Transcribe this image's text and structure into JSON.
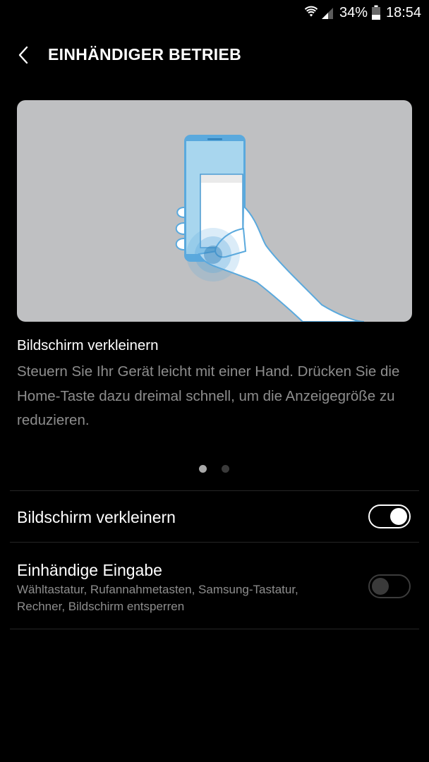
{
  "status_bar": {
    "battery_percent": "34%",
    "time": "18:54",
    "icons": [
      "wifi-icon",
      "signal-icon",
      "battery-icon"
    ]
  },
  "header": {
    "back_icon": "chevron-left-icon",
    "title": "EINHÄNDIGER BETRIEB"
  },
  "illustration": {
    "icon": "one-handed-phone-illustration",
    "pager": {
      "count": 2,
      "active_index": 0
    }
  },
  "description": {
    "title": "Bildschirm verkleinern",
    "body": "Steuern Sie Ihr Gerät leicht mit einer Hand. Drücken Sie die Home-Taste dazu dreimal schnell, um die Anzeigegröße zu reduzieren."
  },
  "settings": [
    {
      "title": "Bildschirm verkleinern",
      "subtitle": "",
      "enabled": true
    },
    {
      "title": "Einhändige Eingabe",
      "subtitle": "Wähltastatur, Rufannahmetasten, Samsung-Tastatur, Rechner, Bildschirm entsperren",
      "enabled": false
    }
  ],
  "colors": {
    "background": "#000000",
    "secondary_text": "#8d8d8d",
    "illustration_bg": "#bfc0c2",
    "phone_blue": "#5aa9dd",
    "phone_screen": "#a8d6ee"
  }
}
